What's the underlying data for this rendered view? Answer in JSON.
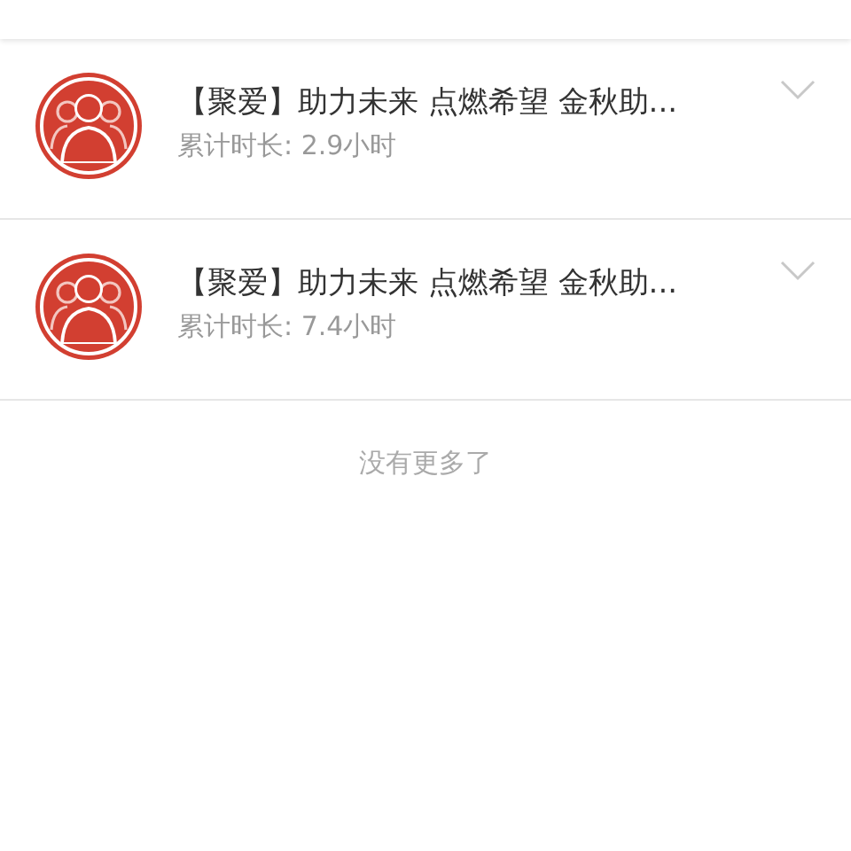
{
  "items": [
    {
      "title": "【聚爱】助力未来 点燃希望 金秋助...",
      "subtitle": "累计时长: 2.9小时"
    },
    {
      "title": "【聚爱】助力未来 点燃希望 金秋助...",
      "subtitle": "累计时长: 7.4小时"
    }
  ],
  "footer": "没有更多了"
}
